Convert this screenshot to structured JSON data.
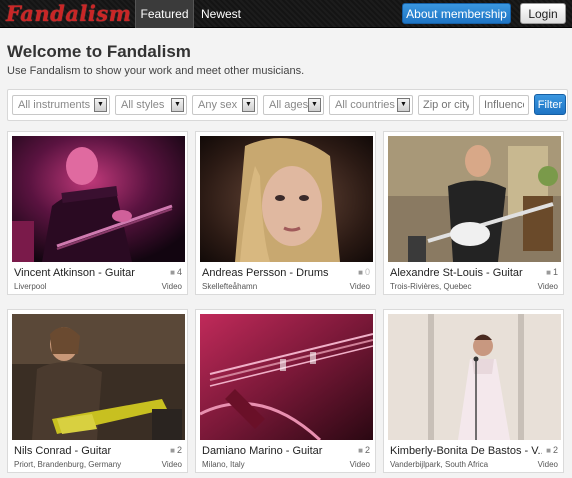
{
  "app": {
    "logo": "Fandalism",
    "nav": [
      {
        "label": "Featured",
        "active": true
      },
      {
        "label": "Newest",
        "active": false
      }
    ],
    "about_label": "About membership",
    "login_label": "Login",
    "accent_color": "#1e74c4",
    "logo_color": "#c92626"
  },
  "header": {
    "title": "Welcome to Fandalism",
    "subtitle": "Use Fandalism to show your work and meet other musicians."
  },
  "filters": {
    "instrument": "All instruments",
    "style": "All styles",
    "sex": "Any sex",
    "age": "All ages",
    "country": "All countries",
    "zip_placeholder": "Zip or city",
    "influence_placeholder": "Influence",
    "filter_label": "Filter"
  },
  "cards": [
    {
      "title": "Vincent Atkinson - Guitar",
      "location": "Liverpool",
      "count": "4",
      "type": "Video"
    },
    {
      "title": "Andreas Persson - Drums",
      "location": "Skellefteåhamn",
      "count": "0",
      "type": "Video"
    },
    {
      "title": "Alexandre St-Louis - Guitar",
      "location": "Trois-Rivières, Quebec",
      "count": "1",
      "type": "Video"
    },
    {
      "title": "Nils Conrad - Guitar",
      "location": "Priort, Brandenburg, Germany",
      "count": "2",
      "type": "Video"
    },
    {
      "title": "Damiano Marino - Guitar",
      "location": "Milano, Italy",
      "count": "2",
      "type": "Video"
    },
    {
      "title": "Kimberly-Bonita De Bastos - V...",
      "location": "Vanderbijlpark, South Africa",
      "count": "2",
      "type": "Video"
    }
  ]
}
